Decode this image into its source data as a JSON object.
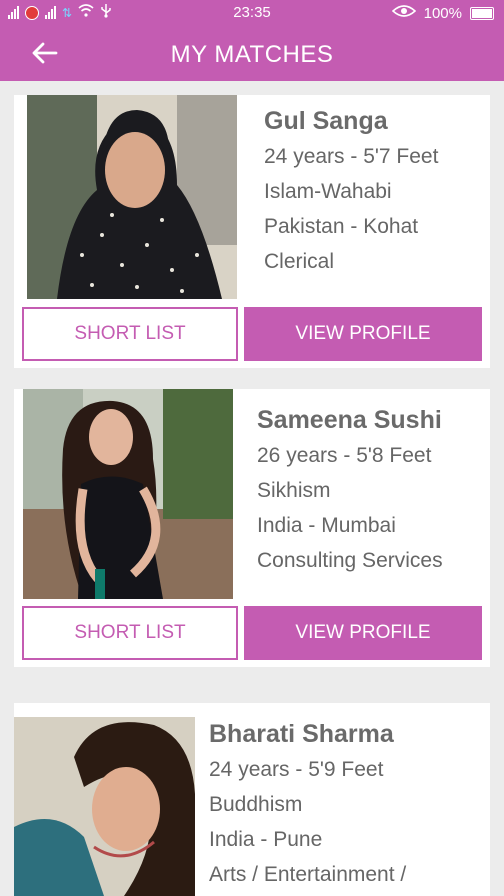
{
  "status_bar": {
    "time": "23:35",
    "battery": "100%",
    "icons": [
      "signal-icon",
      "notification-icon",
      "signal-icon",
      "data-icon",
      "wifi-icon",
      "usb-icon",
      "eye-icon",
      "battery-icon"
    ]
  },
  "header": {
    "title": "MY MATCHES",
    "back_icon": "arrow-left-icon"
  },
  "colors": {
    "accent": "#c45cb2",
    "text": "#666666",
    "background": "#ececec"
  },
  "matches": [
    {
      "name": "Gul Sanga",
      "age_height": "24 years - 5'7 Feet",
      "religion": "Islam-Wahabi",
      "location": "Pakistan - Kohat",
      "profession": "Clerical",
      "shortlist_label": "SHORT LIST",
      "view_label": "VIEW PROFILE"
    },
    {
      "name": "Sameena Sushi",
      "age_height": "26 years - 5'8 Feet",
      "religion": "Sikhism",
      "location": "India - Mumbai",
      "profession": "Consulting Services",
      "shortlist_label": "SHORT LIST",
      "view_label": "VIEW PROFILE"
    },
    {
      "name": "Bharati Sharma",
      "age_height": "24 years - 5'9 Feet",
      "religion": "Buddhism",
      "location": "India - Pune",
      "profession": "Arts / Entertainment /"
    }
  ]
}
